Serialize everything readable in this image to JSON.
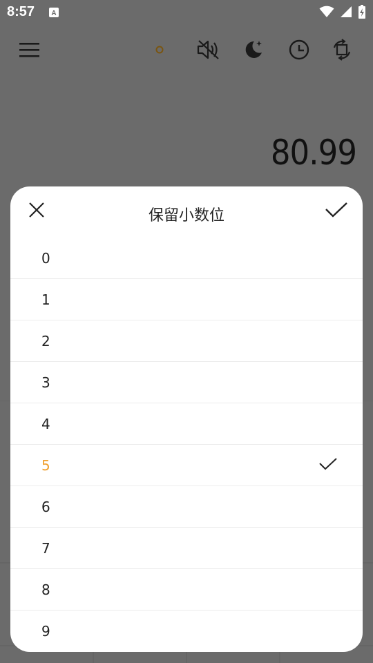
{
  "status_bar": {
    "time": "8:57"
  },
  "display": {
    "value": "80.99"
  },
  "sheet": {
    "title": "保留小数位",
    "options": [
      "0",
      "1",
      "2",
      "3",
      "4",
      "5",
      "6",
      "7",
      "8",
      "9"
    ],
    "selected_option": "5"
  },
  "colors": {
    "accent": "#f0a030",
    "scrim": "#6b6b6b",
    "sheet_bg": "#ffffff"
  },
  "icons": {
    "toolbar": [
      "menu-icon",
      "indicator-dot-icon",
      "sound-off-icon",
      "night-mode-icon",
      "history-clock-icon",
      "rotate-screen-icon"
    ]
  }
}
